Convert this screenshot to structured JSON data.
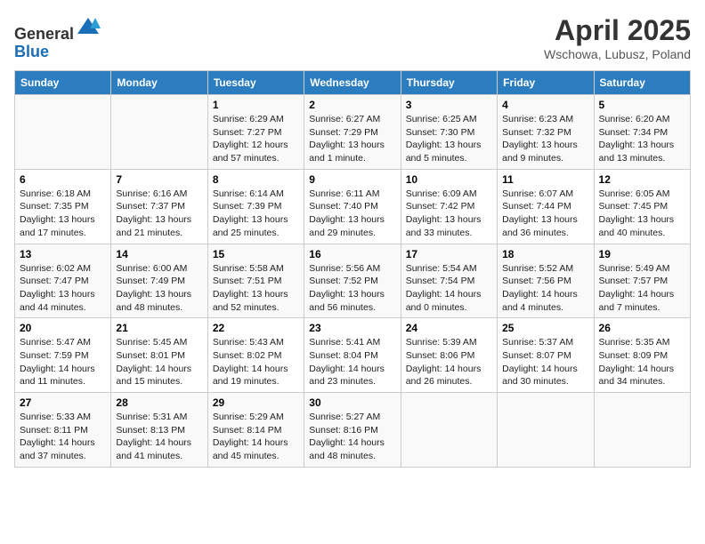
{
  "header": {
    "logo_line1": "General",
    "logo_line2": "Blue",
    "title": "April 2025",
    "subtitle": "Wschowa, Lubusz, Poland"
  },
  "weekdays": [
    "Sunday",
    "Monday",
    "Tuesday",
    "Wednesday",
    "Thursday",
    "Friday",
    "Saturday"
  ],
  "weeks": [
    [
      null,
      null,
      {
        "day": "1",
        "sunrise": "6:29 AM",
        "sunset": "7:27 PM",
        "daylight": "12 hours and 57 minutes."
      },
      {
        "day": "2",
        "sunrise": "6:27 AM",
        "sunset": "7:29 PM",
        "daylight": "13 hours and 1 minute."
      },
      {
        "day": "3",
        "sunrise": "6:25 AM",
        "sunset": "7:30 PM",
        "daylight": "13 hours and 5 minutes."
      },
      {
        "day": "4",
        "sunrise": "6:23 AM",
        "sunset": "7:32 PM",
        "daylight": "13 hours and 9 minutes."
      },
      {
        "day": "5",
        "sunrise": "6:20 AM",
        "sunset": "7:34 PM",
        "daylight": "13 hours and 13 minutes."
      }
    ],
    [
      {
        "day": "6",
        "sunrise": "6:18 AM",
        "sunset": "7:35 PM",
        "daylight": "13 hours and 17 minutes."
      },
      {
        "day": "7",
        "sunrise": "6:16 AM",
        "sunset": "7:37 PM",
        "daylight": "13 hours and 21 minutes."
      },
      {
        "day": "8",
        "sunrise": "6:14 AM",
        "sunset": "7:39 PM",
        "daylight": "13 hours and 25 minutes."
      },
      {
        "day": "9",
        "sunrise": "6:11 AM",
        "sunset": "7:40 PM",
        "daylight": "13 hours and 29 minutes."
      },
      {
        "day": "10",
        "sunrise": "6:09 AM",
        "sunset": "7:42 PM",
        "daylight": "13 hours and 33 minutes."
      },
      {
        "day": "11",
        "sunrise": "6:07 AM",
        "sunset": "7:44 PM",
        "daylight": "13 hours and 36 minutes."
      },
      {
        "day": "12",
        "sunrise": "6:05 AM",
        "sunset": "7:45 PM",
        "daylight": "13 hours and 40 minutes."
      }
    ],
    [
      {
        "day": "13",
        "sunrise": "6:02 AM",
        "sunset": "7:47 PM",
        "daylight": "13 hours and 44 minutes."
      },
      {
        "day": "14",
        "sunrise": "6:00 AM",
        "sunset": "7:49 PM",
        "daylight": "13 hours and 48 minutes."
      },
      {
        "day": "15",
        "sunrise": "5:58 AM",
        "sunset": "7:51 PM",
        "daylight": "13 hours and 52 minutes."
      },
      {
        "day": "16",
        "sunrise": "5:56 AM",
        "sunset": "7:52 PM",
        "daylight": "13 hours and 56 minutes."
      },
      {
        "day": "17",
        "sunrise": "5:54 AM",
        "sunset": "7:54 PM",
        "daylight": "14 hours and 0 minutes."
      },
      {
        "day": "18",
        "sunrise": "5:52 AM",
        "sunset": "7:56 PM",
        "daylight": "14 hours and 4 minutes."
      },
      {
        "day": "19",
        "sunrise": "5:49 AM",
        "sunset": "7:57 PM",
        "daylight": "14 hours and 7 minutes."
      }
    ],
    [
      {
        "day": "20",
        "sunrise": "5:47 AM",
        "sunset": "7:59 PM",
        "daylight": "14 hours and 11 minutes."
      },
      {
        "day": "21",
        "sunrise": "5:45 AM",
        "sunset": "8:01 PM",
        "daylight": "14 hours and 15 minutes."
      },
      {
        "day": "22",
        "sunrise": "5:43 AM",
        "sunset": "8:02 PM",
        "daylight": "14 hours and 19 minutes."
      },
      {
        "day": "23",
        "sunrise": "5:41 AM",
        "sunset": "8:04 PM",
        "daylight": "14 hours and 23 minutes."
      },
      {
        "day": "24",
        "sunrise": "5:39 AM",
        "sunset": "8:06 PM",
        "daylight": "14 hours and 26 minutes."
      },
      {
        "day": "25",
        "sunrise": "5:37 AM",
        "sunset": "8:07 PM",
        "daylight": "14 hours and 30 minutes."
      },
      {
        "day": "26",
        "sunrise": "5:35 AM",
        "sunset": "8:09 PM",
        "daylight": "14 hours and 34 minutes."
      }
    ],
    [
      {
        "day": "27",
        "sunrise": "5:33 AM",
        "sunset": "8:11 PM",
        "daylight": "14 hours and 37 minutes."
      },
      {
        "day": "28",
        "sunrise": "5:31 AM",
        "sunset": "8:13 PM",
        "daylight": "14 hours and 41 minutes."
      },
      {
        "day": "29",
        "sunrise": "5:29 AM",
        "sunset": "8:14 PM",
        "daylight": "14 hours and 45 minutes."
      },
      {
        "day": "30",
        "sunrise": "5:27 AM",
        "sunset": "8:16 PM",
        "daylight": "14 hours and 48 minutes."
      },
      null,
      null,
      null
    ]
  ]
}
